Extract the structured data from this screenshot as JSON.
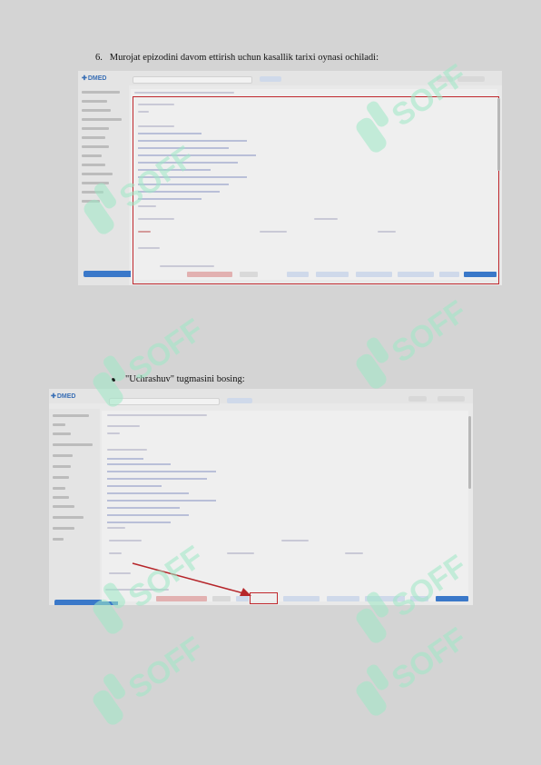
{
  "steps": {
    "step6": {
      "number": "6.",
      "text": "Murojat epizodini davom ettirish uchun kasallik tarixi oynasi ochiladi:"
    },
    "bullet1": {
      "text": "\"Uchrashuv\" tugmasini bosing:"
    }
  },
  "screenshots": {
    "logo_text": "DMED"
  },
  "watermark": {
    "text": "SOFF"
  },
  "colors": {
    "highlight": "#c0282d",
    "brand": "#3a78c9",
    "watermark": "#9ee9c6"
  }
}
